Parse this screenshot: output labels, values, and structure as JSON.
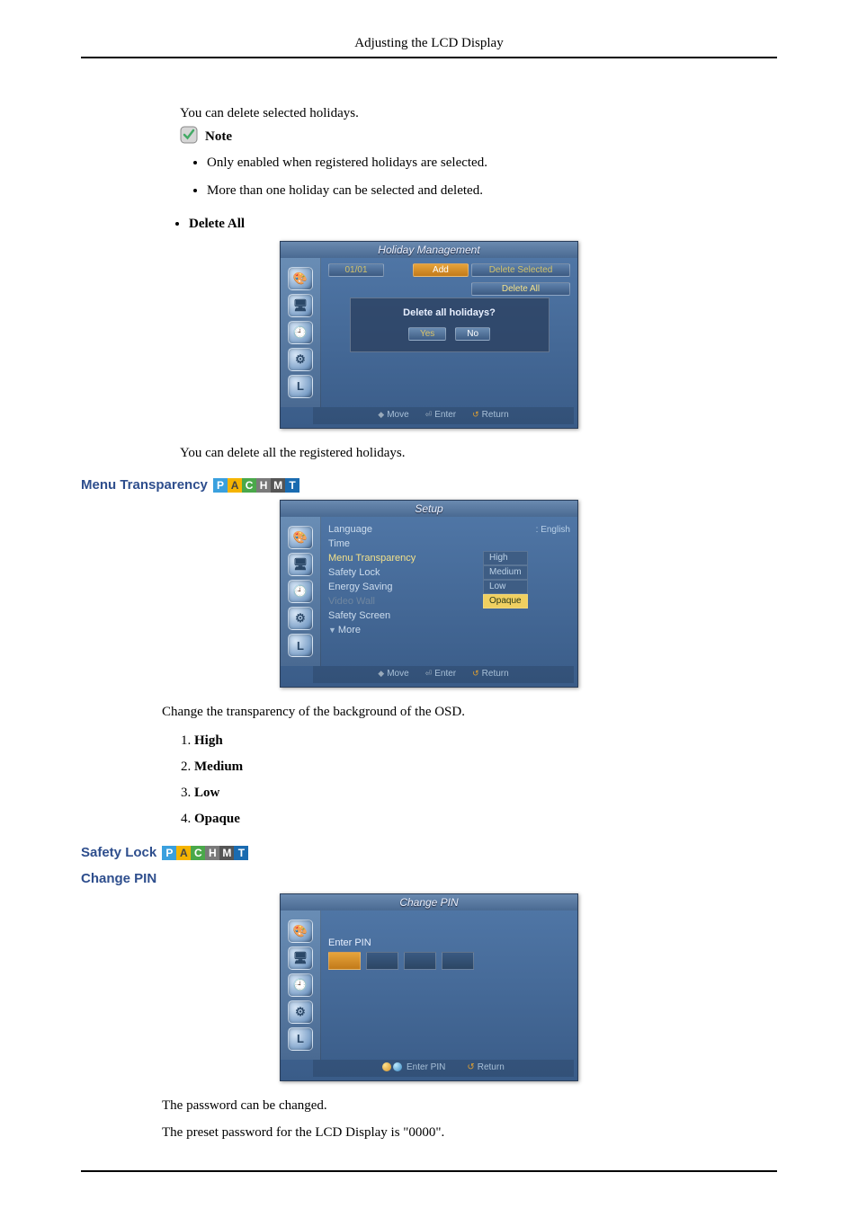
{
  "header": {
    "title": "Adjusting the LCD Display"
  },
  "p1": "You can delete selected holidays.",
  "note_label": "Note",
  "note_items": [
    "Only enabled when registered holidays are selected.",
    "More than one holiday can be selected and deleted."
  ],
  "delete_all_label": "Delete All",
  "osd1": {
    "title": "Holiday Management",
    "date": "01/01",
    "add": "Add",
    "del_sel": "Delete Selected",
    "del_all_hi": "Delete All",
    "dialog_q": "Delete all holidays?",
    "yes": "Yes",
    "no": "No",
    "move": "Move",
    "enter": "Enter",
    "return": "Return"
  },
  "p2": "You can delete all the registered holidays.",
  "sec_menu_transparency": "Menu Transparency",
  "osd2": {
    "title": "Setup",
    "items": {
      "language": "Language",
      "language_val": ": English",
      "time": "Time",
      "menu_transparency": "Menu Transparency",
      "safety_lock": "Safety Lock",
      "energy_saving": "Energy Saving",
      "video_wall": "Video Wall",
      "safety_screen": "Safety Screen",
      "more": "More"
    },
    "opts": {
      "high": "High",
      "medium": "Medium",
      "low": "Low",
      "opaque": "Opaque"
    },
    "move": "Move",
    "enter": "Enter",
    "return": "Return"
  },
  "p3": "Change the transparency of the background of the OSD.",
  "list_opts": [
    "High",
    "Medium",
    "Low",
    "Opaque"
  ],
  "sec_safety_lock": "Safety Lock",
  "sec_change_pin": "Change PIN",
  "osd3": {
    "title": "Change PIN",
    "enter_pin": "Enter PIN",
    "foot_enter_pin": "Enter PIN",
    "return": "Return"
  },
  "p4": "The password can be changed.",
  "p5": "The preset password for the LCD Display is \"0000\".",
  "badges": [
    "P",
    "A",
    "C",
    "H",
    "M",
    "T"
  ]
}
